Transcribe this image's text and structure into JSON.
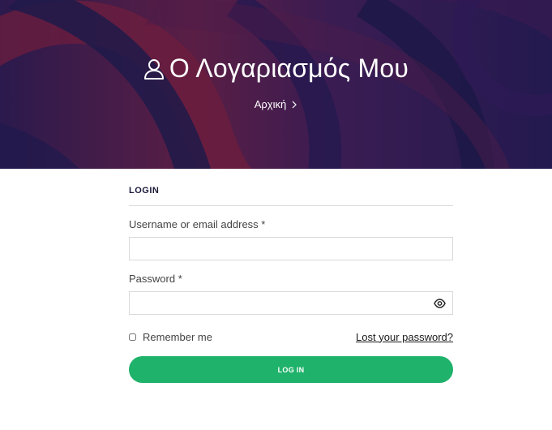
{
  "header": {
    "title": "Ο Λογαριασμός Μου",
    "breadcrumb": "Αρχική"
  },
  "form": {
    "section_title": "LOGIN",
    "username_label": "Username or email address *",
    "username_value": "",
    "password_label": "Password *",
    "password_value": "",
    "remember_label": "Remember me",
    "remember_checked": false,
    "lost_password_label": "Lost your password?",
    "submit_label": "LOG IN"
  },
  "colors": {
    "hero_base": "#1e1b4b",
    "hero_accent": "#7a1f3a",
    "button": "#1fb26a"
  },
  "icons": {
    "title_icon": "user-icon",
    "breadcrumb_icon": "chevron-right-icon",
    "password_toggle": "eye-icon"
  }
}
